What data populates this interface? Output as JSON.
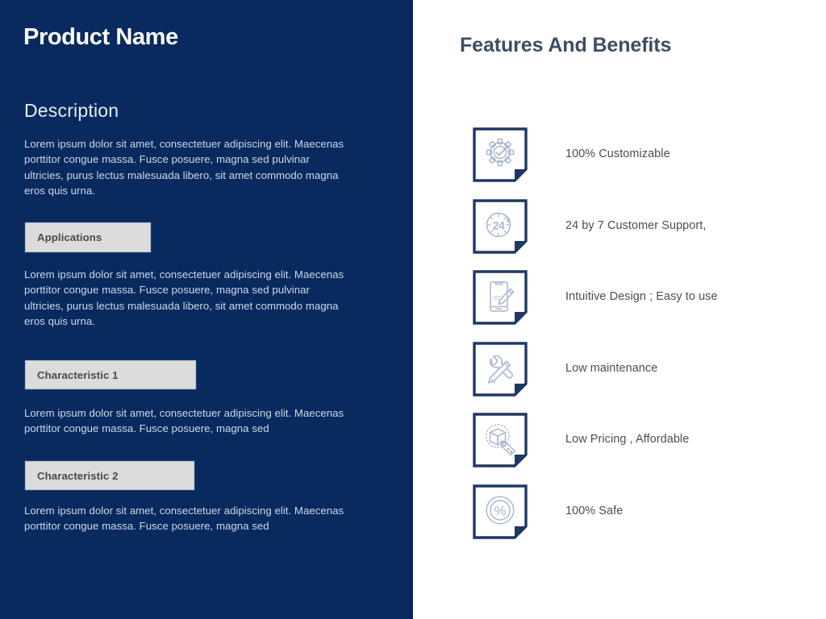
{
  "left_panel": {
    "title": "Product Name",
    "description_heading": "Description",
    "description_body": "Lorem ipsum dolor sit amet, consectetuer adipiscing elit. Maecenas porttitor congue massa. Fusce posuere, magna sed pulvinar ultricies, purus lectus malesuada libero, sit amet commodo magna eros quis urna.",
    "applications_label": "Applications",
    "applications_body": "Lorem ipsum dolor sit amet, consectetuer adipiscing elit. Maecenas porttitor congue massa. Fusce posuere, magna sed pulvinar ultricies, purus lectus malesuada libero, sit amet commodo magna eros quis urna.",
    "characteristic1_label": "Characteristic 1",
    "characteristic1_body": "Lorem ipsum dolor sit amet, consectetuer adipiscing elit. Maecenas porttitor congue massa. Fusce posuere, magna sed",
    "characteristic2_label": "Characteristic 2",
    "characteristic2_body": "Lorem ipsum dolor sit amet, consectetuer adipiscing elit. Maecenas porttitor congue massa. Fusce posuere, magna sed"
  },
  "right_panel": {
    "heading": "Features And Benefits",
    "features": [
      {
        "label": "100% Customizable",
        "icon": "gear-check-icon"
      },
      {
        "label": "24 by 7 Customer Support,",
        "icon": "clock-24-icon"
      },
      {
        "label": "Intuitive Design ; Easy to use",
        "icon": "phone-stylus-icon"
      },
      {
        "label": "Low maintenance",
        "icon": "wrench-screwdriver-icon"
      },
      {
        "label": "Low Pricing , Affordable",
        "icon": "box-price-tag-icon"
      },
      {
        "label": "100% Safe",
        "icon": "percent-circle-icon"
      }
    ]
  },
  "colors": {
    "panel_navy": "#082A5E",
    "chip_gray": "#dcdcdc",
    "chip_text": "#4a4a4a",
    "heading_slate": "#3d4e63",
    "icon_frame_navy": "#1F3864",
    "icon_glyph_blue": "#A9B6D0",
    "body_text": "#cfd8e8",
    "feature_label": "#4d4d4d",
    "background": "#ffffff"
  }
}
